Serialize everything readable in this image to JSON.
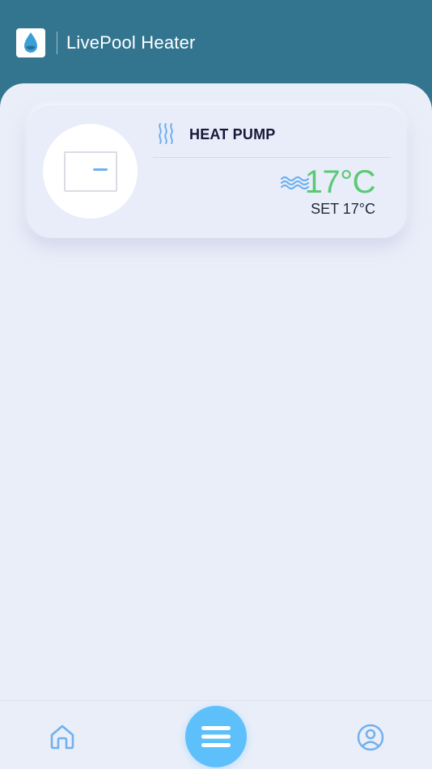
{
  "header": {
    "app_title": "LivePool Heater",
    "logo_icon": "water-drop-icon",
    "background_color": "#33758f"
  },
  "device_card": {
    "title": "HEAT PUMP",
    "title_icon": "heat-waves-icon",
    "water_icon": "water-waves-icon",
    "current_temp": "17°C",
    "set_temp": "SET 17°C",
    "temp_color": "#5bc975"
  },
  "bottom_nav": {
    "items": [
      {
        "id": "home",
        "icon": "home-icon"
      },
      {
        "id": "menu",
        "icon": "menu-icon"
      },
      {
        "id": "profile",
        "icon": "profile-icon"
      }
    ],
    "accent_color": "#5ec0fb"
  }
}
